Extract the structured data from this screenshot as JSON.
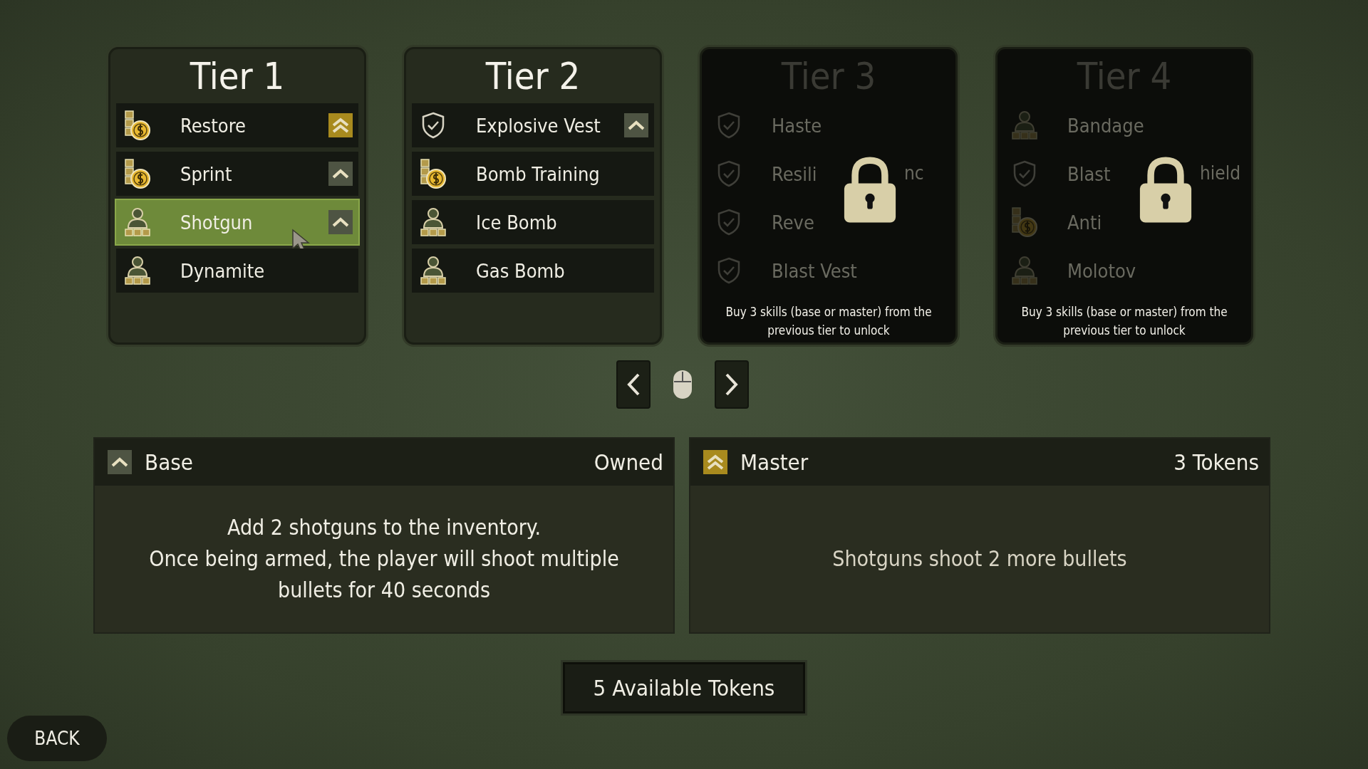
{
  "tiers": [
    {
      "title": "Tier 1",
      "locked": false,
      "skills": [
        {
          "name": "Restore",
          "kind": "coins",
          "badge": true,
          "master": true,
          "selected": false
        },
        {
          "name": "Sprint",
          "kind": "coins",
          "badge": true,
          "master": false,
          "selected": false
        },
        {
          "name": "Shotgun",
          "kind": "person",
          "badge": true,
          "master": false,
          "selected": true
        },
        {
          "name": "Dynamite",
          "kind": "person",
          "badge": false,
          "selected": false
        }
      ]
    },
    {
      "title": "Tier 2",
      "locked": false,
      "skills": [
        {
          "name": "Explosive Vest",
          "kind": "shield",
          "badge": true,
          "master": false,
          "selected": false
        },
        {
          "name": "Bomb Training",
          "kind": "coins",
          "badge": false,
          "selected": false
        },
        {
          "name": "Ice Bomb",
          "kind": "person",
          "badge": false,
          "selected": false
        },
        {
          "name": "Gas Bomb",
          "kind": "person",
          "badge": false,
          "selected": false
        }
      ]
    },
    {
      "title": "Tier 3",
      "locked": true,
      "lock_message": "Buy 3 skills (base or master) from the previous tier to unlock",
      "skills": [
        {
          "name": "Haste",
          "kind": "shield",
          "badge": false,
          "selected": false
        },
        {
          "name": "Resili",
          "name_tail": "nc",
          "kind": "shield",
          "badge": false,
          "selected": false
        },
        {
          "name": "Reve",
          "kind": "shield",
          "badge": false,
          "selected": false
        },
        {
          "name": "Blast Vest",
          "kind": "shield",
          "badge": false,
          "selected": false
        }
      ]
    },
    {
      "title": "Tier 4",
      "locked": true,
      "lock_message": "Buy 3 skills (base or master) from the previous tier to unlock",
      "skills": [
        {
          "name": "Bandage",
          "kind": "person",
          "badge": false,
          "selected": false
        },
        {
          "name": "Blast",
          "name_tail": "hield",
          "kind": "shield",
          "badge": false,
          "selected": false
        },
        {
          "name": "Anti",
          "kind": "coins",
          "badge": false,
          "selected": false
        },
        {
          "name": "Molotov",
          "kind": "person",
          "badge": false,
          "selected": false
        }
      ]
    }
  ],
  "details": [
    {
      "kind": "base",
      "title": "Base",
      "status": "Owned",
      "description": "Add 2 shotguns to the inventory.\nOnce being armed, the player will shoot multiple\nbullets for 40 seconds"
    },
    {
      "kind": "master",
      "title": "Master",
      "status": "3 Tokens",
      "description": "Shotguns shoot 2 more bullets"
    }
  ],
  "tokens": "5 Available Tokens",
  "back": "BACK"
}
